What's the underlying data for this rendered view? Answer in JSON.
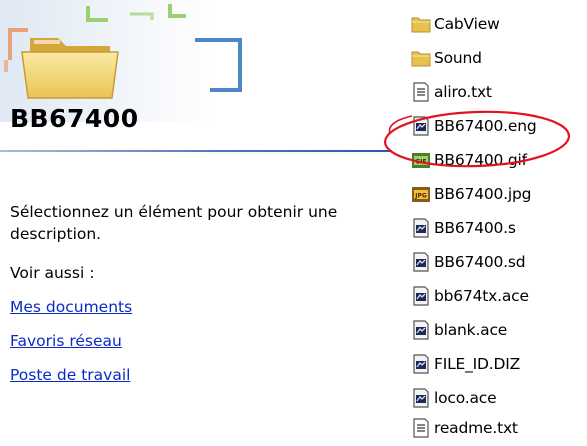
{
  "left_panel": {
    "folder_title": "BB67400",
    "description": "Sélectionnez un élément pour obtenir une description.",
    "see_also_label": "Voir aussi :",
    "links": [
      {
        "label": "Mes documents"
      },
      {
        "label": "Favoris réseau"
      },
      {
        "label": "Poste de travail"
      }
    ]
  },
  "files": [
    {
      "name": "CabView",
      "icon": "folder-icon"
    },
    {
      "name": "Sound",
      "icon": "folder-icon"
    },
    {
      "name": "aliro.txt",
      "icon": "text-file-icon"
    },
    {
      "name": "BB67400.eng",
      "icon": "ace-file-icon",
      "circled": true
    },
    {
      "name": "BB67400.gif",
      "icon": "gif-file-icon"
    },
    {
      "name": "BB67400.jpg",
      "icon": "jpg-file-icon"
    },
    {
      "name": "BB67400.s",
      "icon": "ace-file-icon"
    },
    {
      "name": "BB67400.sd",
      "icon": "ace-file-icon"
    },
    {
      "name": "bb674tx.ace",
      "icon": "ace-file-icon"
    },
    {
      "name": "blank.ace",
      "icon": "ace-file-icon"
    },
    {
      "name": "FILE_ID.DIZ",
      "icon": "ace-file-icon"
    },
    {
      "name": "loco.ace",
      "icon": "ace-file-icon"
    },
    {
      "name": "readme.txt",
      "icon": "text-file-icon"
    }
  ],
  "colors": {
    "link": "#0a2ac8",
    "highlight_ring": "#e0141e",
    "title_rule": "#2a5aa8"
  }
}
